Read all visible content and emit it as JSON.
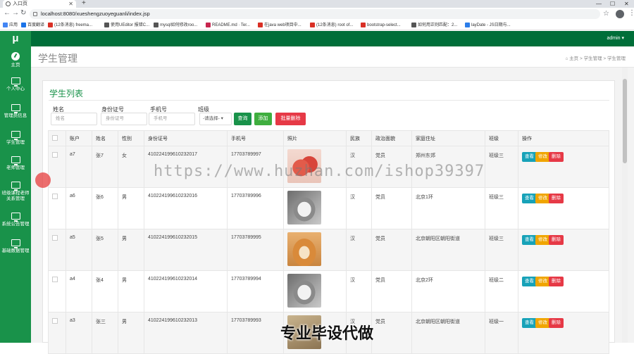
{
  "browser": {
    "tab_title": "入口页",
    "url": "localhost:8080/xueshengzuoyeguanli/index.jsp",
    "bookmarks": [
      "应用",
      "百度翻译",
      "(12条消息) freema...",
      "使用UEditor 报错C...",
      "mysql如何修改roo...",
      "README.md · Ter...",
      "在java web项目中...",
      "(12条消息) root of...",
      "bootstrap-select...",
      "如何用正则匹配：2...",
      "layDate - JS日期与..."
    ],
    "bookmark_colors": [
      "#4285f4",
      "#1a73e8",
      "#d93025",
      "#555555",
      "#555555",
      "#c7254e",
      "#d93025",
      "#d93025",
      "#d93025",
      "#555555",
      "#2b7de9"
    ]
  },
  "sidebar": {
    "logo": "μ",
    "items": [
      {
        "label": "主页",
        "icon": "dashboard-icon"
      },
      {
        "label": "个人中心",
        "icon": "monitor-icon"
      },
      {
        "label": "管理员信息",
        "icon": "monitor-icon"
      },
      {
        "label": "学生管理",
        "icon": "monitor-icon"
      },
      {
        "label": "老师管理",
        "icon": "monitor-icon"
      },
      {
        "label": "班级课程老师关系管理",
        "icon": "monitor-icon"
      },
      {
        "label": "系统公告管理",
        "icon": "monitor-icon"
      },
      {
        "label": "基础数据管理",
        "icon": "monitor-icon"
      }
    ]
  },
  "header": {
    "user": "admin ▾"
  },
  "page": {
    "title": "学生管理",
    "breadcrumb": "⌂ 主页 > 学生管理 > 学生管理"
  },
  "card": {
    "title": "学生列表"
  },
  "search": {
    "name_label": "姓名",
    "name_placeholder": "姓名",
    "id_label": "身份证号",
    "id_placeholder": "身份证号",
    "phone_label": "手机号",
    "phone_placeholder": "手机号",
    "class_label": "班级",
    "class_value": "-请选择-  ▾",
    "query": "查询",
    "add": "添加",
    "batch_delete": "批量删除"
  },
  "colors": {
    "sidebar": "#19924a",
    "topbar": "#006e39",
    "query": "#19924a",
    "add": "#3fae3f",
    "batch_delete": "#e63946"
  },
  "table": {
    "headers": [
      "",
      "账户",
      "姓名",
      "性别",
      "身份证号",
      "手机号",
      "照片",
      "民族",
      "政治面貌",
      "家庭住址",
      "班级",
      "操作"
    ],
    "actions": {
      "view": "查看",
      "edit": "修改",
      "delete": "删除"
    },
    "rows": [
      {
        "account": "a7",
        "name": "张7",
        "gender": "女",
        "idcard": "410224199610232017",
        "phone": "17703789997",
        "photo": "apple-photo",
        "ethnicity": "汉",
        "political": "党员",
        "address": "郑州东郊",
        "class": "班级三"
      },
      {
        "account": "a6",
        "name": "张6",
        "gender": "男",
        "idcard": "410224199610232016",
        "phone": "17703789996",
        "photo": "cat-photo",
        "ethnicity": "汉",
        "political": "党员",
        "address": "北京1环",
        "class": "班级三"
      },
      {
        "account": "a5",
        "name": "张5",
        "gender": "男",
        "idcard": "410224199610232015",
        "phone": "17703789995",
        "photo": "dog-photo",
        "ethnicity": "汉",
        "political": "党员",
        "address": "北京朝阳区朝阳街道",
        "class": "班级三"
      },
      {
        "account": "a4",
        "name": "张4",
        "gender": "男",
        "idcard": "410224199610232014",
        "phone": "17703789994",
        "photo": "cat-photo",
        "ethnicity": "汉",
        "political": "党员",
        "address": "北京2环",
        "class": "班级二"
      },
      {
        "account": "a3",
        "name": "张三",
        "gender": "男",
        "idcard": "410224199610232013",
        "phone": "17703789993",
        "photo": "book-photo",
        "ethnicity": "汉",
        "political": "党员",
        "address": "北京朝阳区朝阳街道",
        "class": "班级一"
      }
    ]
  },
  "watermark": "https://www.huzhan.com/ishop39397",
  "overlay_text": "专业毕设代做"
}
